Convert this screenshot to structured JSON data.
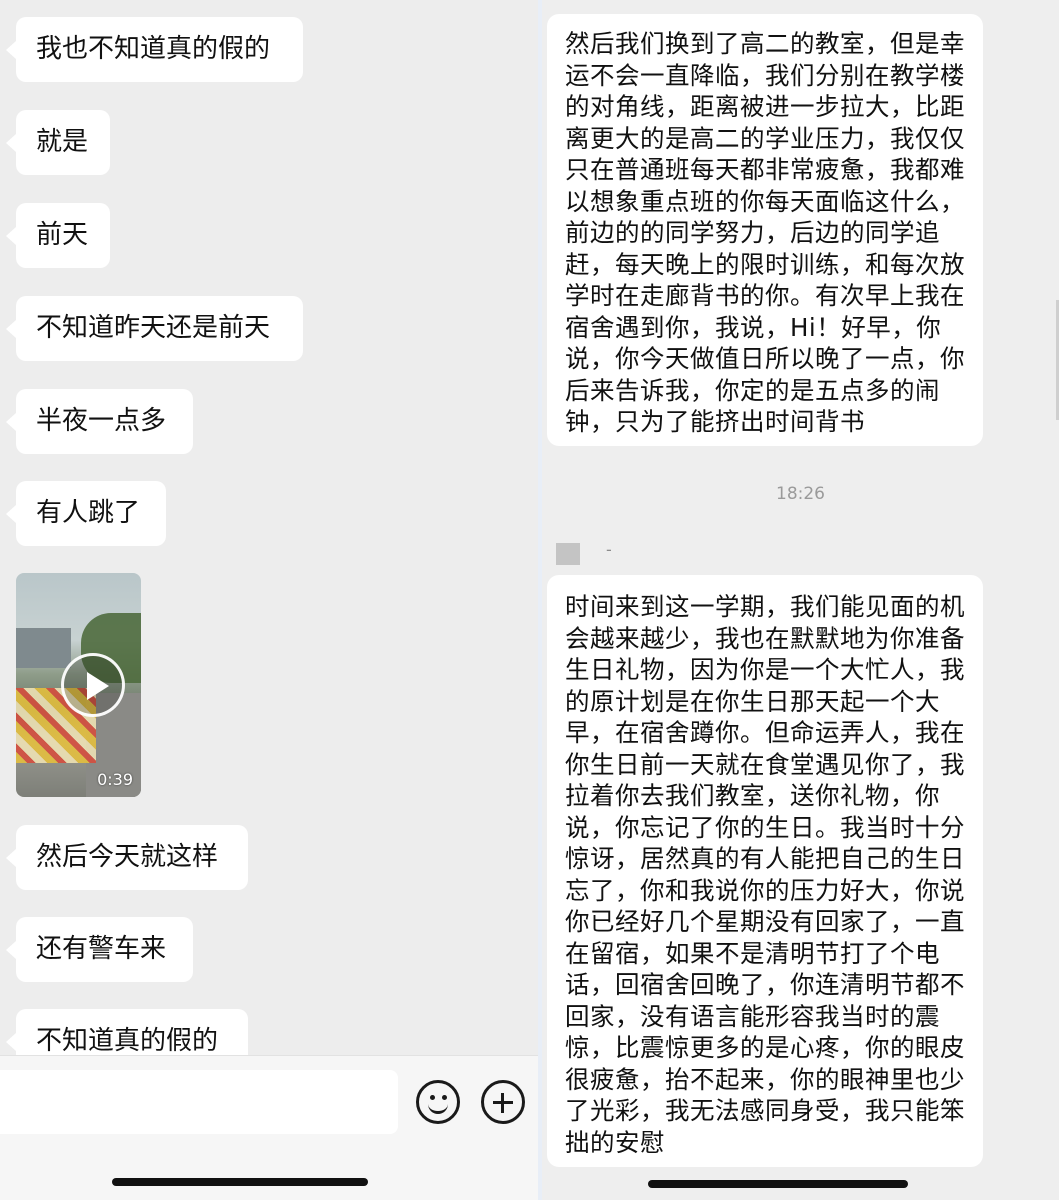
{
  "left_chat": {
    "messages": [
      "我也不知道真的假的",
      "就是",
      "前天",
      "不知道昨天还是前天",
      "半夜一点多",
      "有人跳了"
    ],
    "video": {
      "duration": "0:39",
      "play_icon": "play-icon"
    },
    "messages_after": [
      "然后今天就这样",
      "还有警车来",
      "不知道真的假的"
    ],
    "input": {
      "value": "",
      "emoji_icon": "emoji-icon",
      "plus_icon": "plus-circle-icon"
    }
  },
  "right_chat": {
    "message_1_lines": [
      "然后我们换到了高二的教室，但是幸",
      "运不会一直降临，我们分别在教学楼",
      "的对角线，距离被进一步拉大，比距",
      "离更大的是高二的学业压力，我仅仅",
      "只在普通班每天都非常疲惫，我都难",
      "以想象重点班的你每天面临这什么，",
      "前边的的同学努力，后边的同学追",
      "赶，每天晚上的限时训练，和每次放",
      "学时在走廊背书的你。有次早上我在",
      "宿舍遇到你，我说，Hi！好早，你",
      "说，你今天做值日所以晚了一点，你",
      "后来告诉我，你定的是五点多的闹",
      "钟，只为了能挤出时间背书"
    ],
    "timestamp": "18:26",
    "sender_name": "-",
    "message_2_lines": [
      "时间来到这一学期，我们能见面的机",
      "会越来越少，我也在默默地为你准备",
      "生日礼物，因为你是一个大忙人，我",
      "的原计划是在你生日那天起一个大",
      "早，在宿舍蹲你。但命运弄人，我在",
      "你生日前一天就在食堂遇见你了，我",
      "拉着你去我们教室，送你礼物，你",
      "说，你忘记了你的生日。我当时十分",
      "惊讶，居然真的有人能把自己的生日",
      "忘了，你和我说你的压力好大，你说",
      "你已经好几个星期没有回家了，一直",
      "在留宿，如果不是清明节打了个电",
      "话，回宿舍回晚了，你连清明节都不",
      "回家，没有语言能形容我当时的震",
      "惊，比震惊更多的是心疼，你的眼皮",
      "很疲惫，抬不起来，你的眼神里也少",
      "了光彩，我无法感同身受，我只能笨",
      "拙的安慰"
    ]
  }
}
